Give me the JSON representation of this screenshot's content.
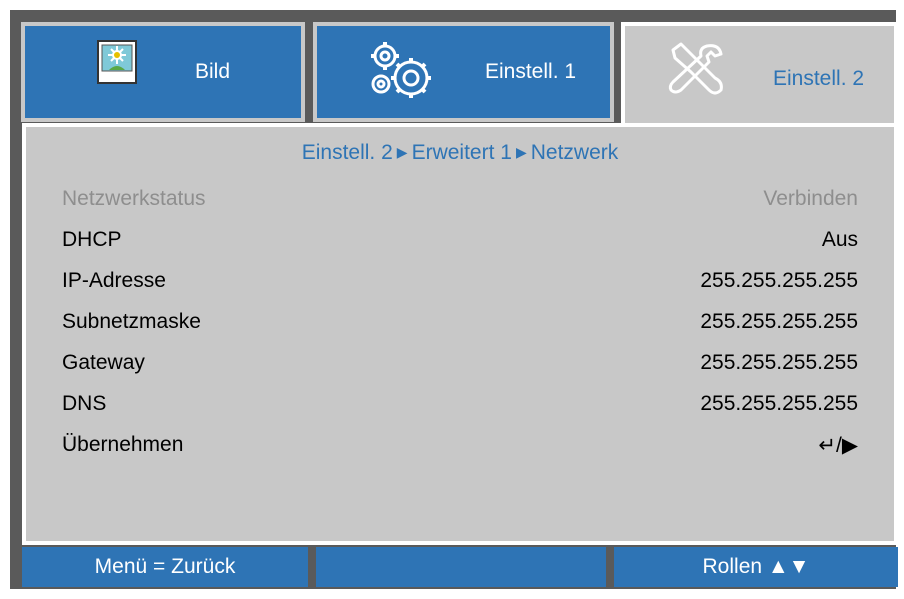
{
  "tabs": [
    {
      "label": "Bild",
      "active": false,
      "icon": "picture-icon"
    },
    {
      "label": "Einstell. 1",
      "active": false,
      "icon": "gears-icon"
    },
    {
      "label": "Einstell. 2",
      "active": true,
      "icon": "tools-icon"
    }
  ],
  "breadcrumb": {
    "part1": "Einstell. 2",
    "part2": "Erweitert 1",
    "part3": "Netzwerk",
    "separator": "▶"
  },
  "rows": [
    {
      "label": "Netzwerkstatus",
      "value": "Verbinden",
      "disabled": true
    },
    {
      "label": "DHCP",
      "value": "Aus"
    },
    {
      "label": "IP-Adresse",
      "value": "255.255.255.255"
    },
    {
      "label": "Subnetzmaske",
      "value": "255.255.255.255"
    },
    {
      "label": "Gateway",
      "value": "255.255.255.255"
    },
    {
      "label": "DNS",
      "value": "255.255.255.255"
    },
    {
      "label": "Übernehmen",
      "value": "↵/▶"
    }
  ],
  "footer": {
    "left": "Menü = Zurück",
    "middle": "",
    "right": "Rollen ▲▼"
  },
  "colors": {
    "accent": "#2e74b5",
    "panel": "#c8c8c8",
    "frame": "#5a5a5a",
    "disabled_text": "#8e8e8e"
  }
}
